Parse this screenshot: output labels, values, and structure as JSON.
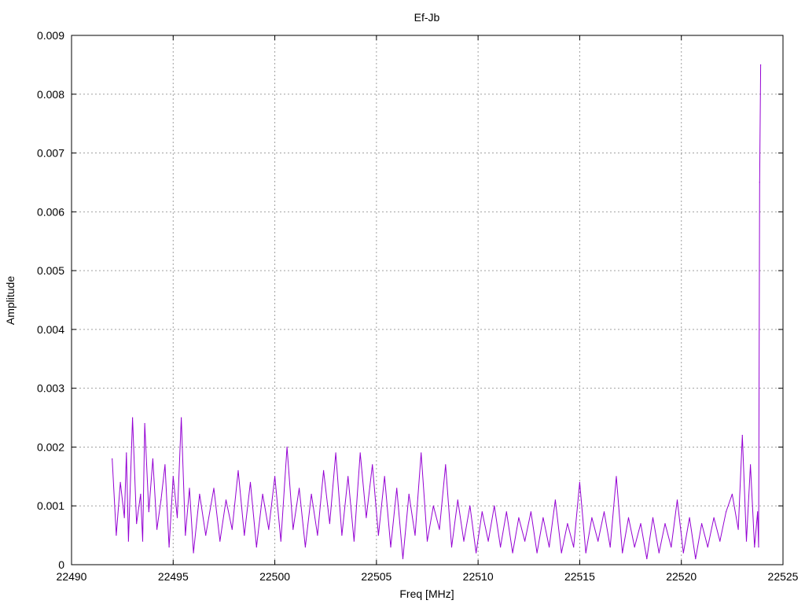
{
  "chart_data": {
    "type": "line",
    "title": "Ef-Jb",
    "xlabel": "Freq [MHz]",
    "ylabel": "Amplitude",
    "xlim": [
      22490,
      22525
    ],
    "ylim": [
      0,
      0.009
    ],
    "xticks": [
      22490,
      22495,
      22500,
      22505,
      22510,
      22515,
      22520,
      22525
    ],
    "xtick_labels": [
      "22490",
      "22495",
      "22500",
      "22505",
      "22510",
      "22515",
      "22520",
      "22525"
    ],
    "yticks": [
      0,
      0.001,
      0.002,
      0.003,
      0.004,
      0.005,
      0.006,
      0.007,
      0.008,
      0.009
    ],
    "ytick_labels": [
      "0",
      "0.001",
      "0.002",
      "0.003",
      "0.004",
      "0.005",
      "0.006",
      "0.007",
      "0.008",
      "0.009"
    ],
    "grid": true,
    "series": [
      {
        "color": "#9400d3",
        "x": [
          22492.0,
          22492.2,
          22492.4,
          22492.6,
          22492.7,
          22492.8,
          22493.0,
          22493.2,
          22493.4,
          22493.5,
          22493.6,
          22493.8,
          22494.0,
          22494.2,
          22494.4,
          22494.6,
          22494.8,
          22495.0,
          22495.2,
          22495.4,
          22495.6,
          22495.8,
          22496.0,
          22496.3,
          22496.6,
          22497.0,
          22497.3,
          22497.6,
          22497.9,
          22498.2,
          22498.5,
          22498.8,
          22499.1,
          22499.4,
          22499.7,
          22500.0,
          22500.3,
          22500.6,
          22500.9,
          22501.2,
          22501.5,
          22501.8,
          22502.1,
          22502.4,
          22502.7,
          22503.0,
          22503.3,
          22503.6,
          22503.9,
          22504.2,
          22504.5,
          22504.8,
          22505.1,
          22505.4,
          22505.7,
          22506.0,
          22506.3,
          22506.6,
          22506.9,
          22507.2,
          22507.5,
          22507.8,
          22508.1,
          22508.4,
          22508.7,
          22509.0,
          22509.3,
          22509.6,
          22509.9,
          22510.2,
          22510.5,
          22510.8,
          22511.1,
          22511.4,
          22511.7,
          22512.0,
          22512.3,
          22512.6,
          22512.9,
          22513.2,
          22513.5,
          22513.8,
          22514.1,
          22514.4,
          22514.7,
          22515.0,
          22515.3,
          22515.6,
          22515.9,
          22516.2,
          22516.5,
          22516.8,
          22517.1,
          22517.4,
          22517.7,
          22518.0,
          22518.3,
          22518.6,
          22518.9,
          22519.2,
          22519.5,
          22519.8,
          22520.1,
          22520.4,
          22520.7,
          22521.0,
          22521.3,
          22521.6,
          22521.9,
          22522.2,
          22522.5,
          22522.8,
          22523.0,
          22523.2,
          22523.4,
          22523.6,
          22523.75,
          22523.8,
          22523.85,
          22523.9
        ],
        "y": [
          0.0018,
          0.0005,
          0.0014,
          0.0008,
          0.0019,
          0.0004,
          0.0025,
          0.0007,
          0.0012,
          0.0004,
          0.0024,
          0.0009,
          0.0018,
          0.0006,
          0.0011,
          0.0017,
          0.0003,
          0.0015,
          0.0008,
          0.0025,
          0.0005,
          0.0013,
          0.0002,
          0.0012,
          0.0005,
          0.0013,
          0.0004,
          0.0011,
          0.0006,
          0.0016,
          0.0005,
          0.0014,
          0.0003,
          0.0012,
          0.0006,
          0.0015,
          0.0004,
          0.002,
          0.0006,
          0.0013,
          0.0003,
          0.0012,
          0.0005,
          0.0016,
          0.0007,
          0.0019,
          0.0005,
          0.0015,
          0.0004,
          0.0019,
          0.0008,
          0.0017,
          0.0005,
          0.0015,
          0.0003,
          0.0013,
          0.0001,
          0.0012,
          0.0005,
          0.0019,
          0.0004,
          0.001,
          0.0006,
          0.0017,
          0.0003,
          0.0011,
          0.0004,
          0.001,
          0.0002,
          0.0009,
          0.0004,
          0.001,
          0.0003,
          0.0009,
          0.0002,
          0.0008,
          0.0004,
          0.0009,
          0.0002,
          0.0008,
          0.0003,
          0.0011,
          0.0002,
          0.0007,
          0.0003,
          0.0014,
          0.0002,
          0.0008,
          0.0004,
          0.0009,
          0.0003,
          0.0015,
          0.0002,
          0.0008,
          0.0003,
          0.0007,
          0.0001,
          0.0008,
          0.0002,
          0.0007,
          0.0003,
          0.0011,
          0.0002,
          0.0008,
          0.0001,
          0.0007,
          0.0003,
          0.0008,
          0.0004,
          0.0009,
          0.0012,
          0.0006,
          0.0022,
          0.0004,
          0.0017,
          0.0003,
          0.0009,
          0.0003,
          0.0065,
          0.0085
        ]
      }
    ]
  }
}
